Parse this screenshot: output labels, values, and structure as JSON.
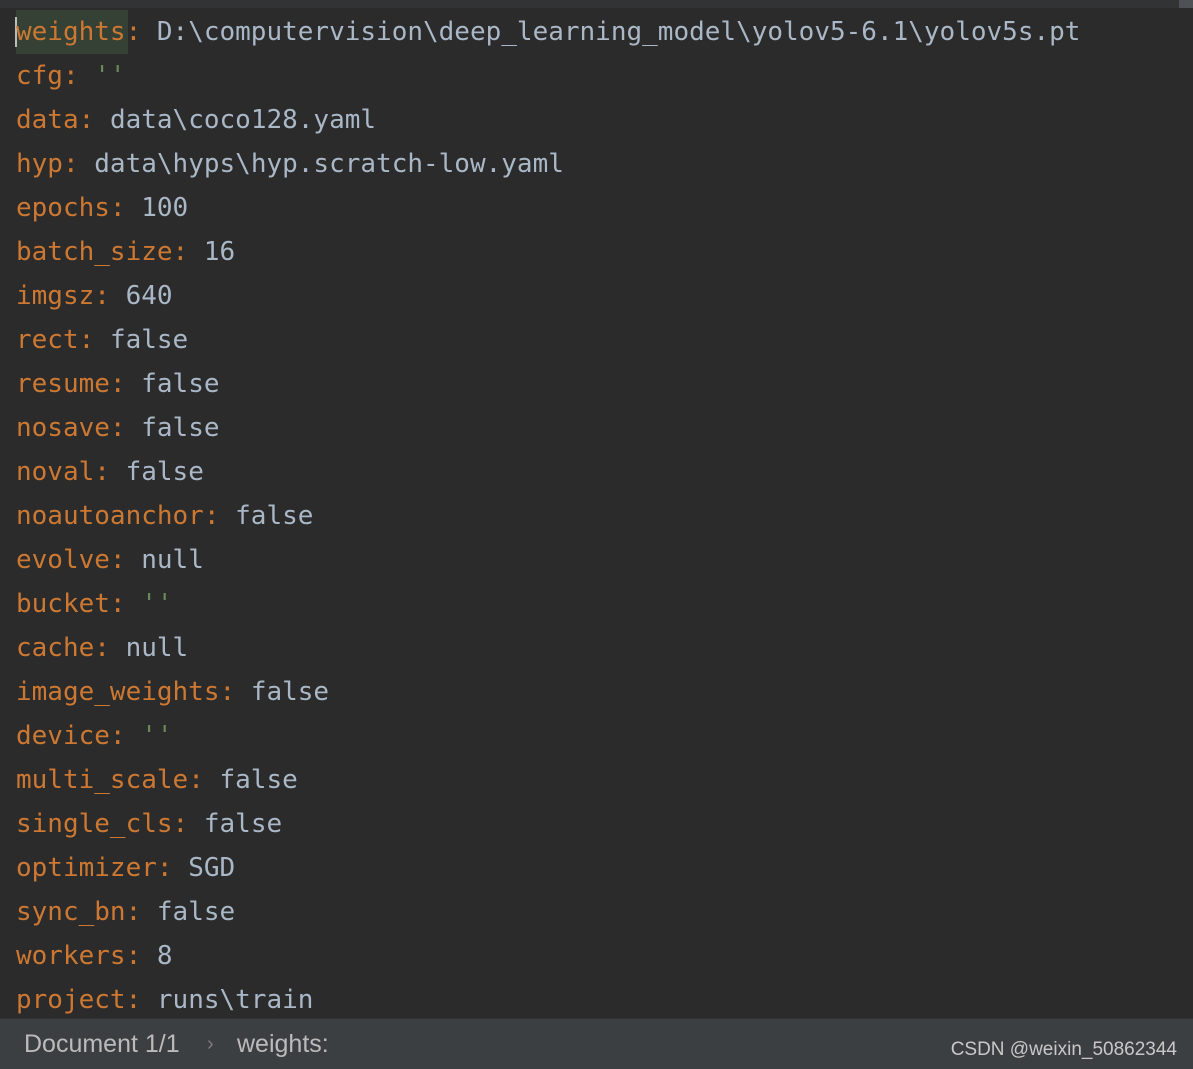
{
  "colors": {
    "background": "#2b2b2b",
    "key": "#cc7832",
    "value": "#a9b7c6",
    "string": "#6a8759",
    "current_line": "#344134",
    "statusbar": "#3c3f41"
  },
  "editor": {
    "lines": [
      {
        "key": "weights",
        "value": "D:\\computervision\\deep_learning_model\\yolov5-6.1\\yolov5s.pt",
        "type": "plain"
      },
      {
        "key": "cfg",
        "value": "''",
        "type": "string"
      },
      {
        "key": "data",
        "value": "data\\coco128.yaml",
        "type": "plain"
      },
      {
        "key": "hyp",
        "value": "data\\hyps\\hyp.scratch-low.yaml",
        "type": "plain"
      },
      {
        "key": "epochs",
        "value": "100",
        "type": "plain"
      },
      {
        "key": "batch_size",
        "value": "16",
        "type": "plain"
      },
      {
        "key": "imgsz",
        "value": "640",
        "type": "plain"
      },
      {
        "key": "rect",
        "value": "false",
        "type": "plain"
      },
      {
        "key": "resume",
        "value": "false",
        "type": "plain"
      },
      {
        "key": "nosave",
        "value": "false",
        "type": "plain"
      },
      {
        "key": "noval",
        "value": "false",
        "type": "plain"
      },
      {
        "key": "noautoanchor",
        "value": "false",
        "type": "plain"
      },
      {
        "key": "evolve",
        "value": "null",
        "type": "plain"
      },
      {
        "key": "bucket",
        "value": "''",
        "type": "string"
      },
      {
        "key": "cache",
        "value": "null",
        "type": "plain"
      },
      {
        "key": "image_weights",
        "value": "false",
        "type": "plain"
      },
      {
        "key": "device",
        "value": "''",
        "type": "string"
      },
      {
        "key": "multi_scale",
        "value": "false",
        "type": "plain"
      },
      {
        "key": "single_cls",
        "value": "false",
        "type": "plain"
      },
      {
        "key": "optimizer",
        "value": "SGD",
        "type": "plain"
      },
      {
        "key": "sync_bn",
        "value": "false",
        "type": "plain"
      },
      {
        "key": "workers",
        "value": "8",
        "type": "plain"
      },
      {
        "key": "project",
        "value": "runs\\train",
        "type": "plain"
      }
    ]
  },
  "statusbar": {
    "document": "Document 1/1",
    "separator": "›",
    "current_key": "weights:",
    "watermark": "CSDN @weixin_50862344"
  }
}
